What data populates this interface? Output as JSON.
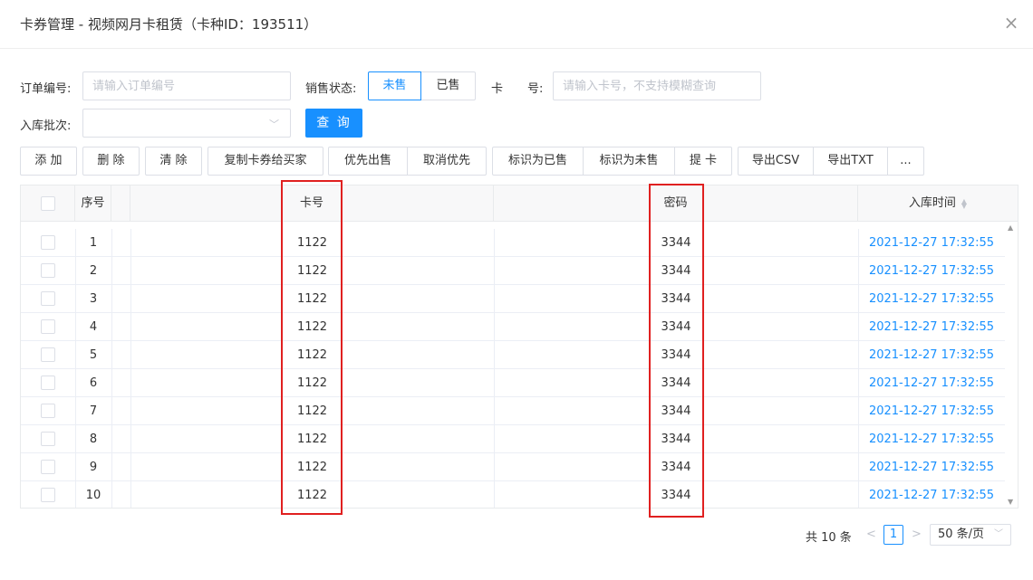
{
  "dialog": {
    "title": "卡券管理 - 视频网月卡租赁（卡种ID：193511）",
    "close_icon": "×"
  },
  "filters": {
    "order_label": "订单编号:",
    "order_placeholder": "请输入订单编号",
    "order_value": "",
    "status_label": "销售状态:",
    "status_unsold": "未售",
    "status_sold": "已售",
    "status_selected": "未售",
    "card_label_1": "卡",
    "card_label_2": "号:",
    "card_placeholder": "请输入卡号，不支持模糊查询",
    "card_value": "",
    "batch_label": "入库批次:",
    "batch_value": "",
    "query_button": "查 询"
  },
  "toolbar": {
    "add": "添 加",
    "delete": "删 除",
    "clear": "清 除",
    "copy_to_buyer": "复制卡券给买家",
    "priority_sell": "优先出售",
    "cancel_priority": "取消优先",
    "mark_sold": "标识为已售",
    "mark_unsold": "标识为未售",
    "withdraw": "提 卡",
    "export_csv": "导出CSV",
    "export_txt": "导出TXT",
    "more": "..."
  },
  "table": {
    "headers": {
      "index": "序号",
      "card_no": "卡号",
      "password": "密码",
      "in_time": "入库时间"
    },
    "rows": [
      {
        "index": "1",
        "card_no": "1122",
        "password": "3344",
        "in_time": "2021-12-27 17:32:55"
      },
      {
        "index": "2",
        "card_no": "1122",
        "password": "3344",
        "in_time": "2021-12-27 17:32:55"
      },
      {
        "index": "3",
        "card_no": "1122",
        "password": "3344",
        "in_time": "2021-12-27 17:32:55"
      },
      {
        "index": "4",
        "card_no": "1122",
        "password": "3344",
        "in_time": "2021-12-27 17:32:55"
      },
      {
        "index": "5",
        "card_no": "1122",
        "password": "3344",
        "in_time": "2021-12-27 17:32:55"
      },
      {
        "index": "6",
        "card_no": "1122",
        "password": "3344",
        "in_time": "2021-12-27 17:32:55"
      },
      {
        "index": "7",
        "card_no": "1122",
        "password": "3344",
        "in_time": "2021-12-27 17:32:55"
      },
      {
        "index": "8",
        "card_no": "1122",
        "password": "3344",
        "in_time": "2021-12-27 17:32:55"
      },
      {
        "index": "9",
        "card_no": "1122",
        "password": "3344",
        "in_time": "2021-12-27 17:32:55"
      },
      {
        "index": "10",
        "card_no": "1122",
        "password": "3344",
        "in_time": "2021-12-27 17:32:55"
      }
    ]
  },
  "pagination": {
    "total": "共 10 条",
    "prev": "<",
    "current_page": "1",
    "next": ">",
    "page_size": "50 条/页"
  },
  "colors": {
    "accent": "#1890ff",
    "highlight_box": "#e02020"
  }
}
